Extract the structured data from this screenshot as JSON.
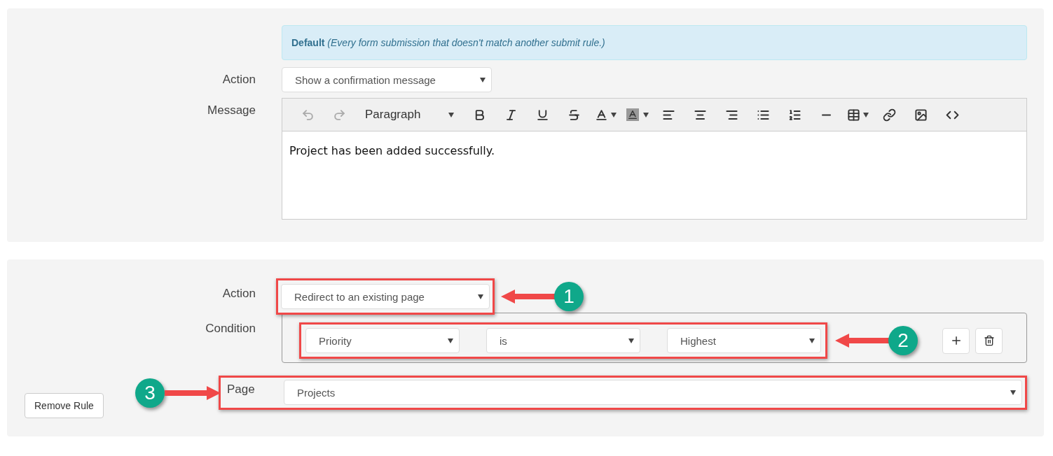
{
  "default_rule": {
    "alert": "**Default** *(Every form submission that doesn't match another submit rule.)*",
    "action": {
      "label": "Action",
      "value": "Show a confirmation message"
    },
    "message": {
      "label": "Message",
      "format": "Paragraph",
      "text": "Project has been added successfully."
    }
  },
  "rule": {
    "action": {
      "label": "Action",
      "value": "Redirect to an existing page"
    },
    "condition": {
      "label": "Condition",
      "field": "Priority",
      "operator": "is",
      "value": "Highest"
    },
    "page": {
      "label": "Page",
      "value": "Projects"
    },
    "remove_button": "Remove Rule"
  },
  "callouts": [
    "1",
    "2",
    "3"
  ]
}
